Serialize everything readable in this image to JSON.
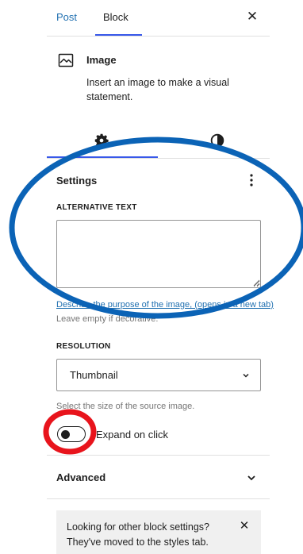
{
  "header": {
    "tabs": [
      {
        "label": "Post",
        "active": false
      },
      {
        "label": "Block",
        "active": true
      }
    ],
    "close_icon": "close-icon"
  },
  "block": {
    "icon": "image-icon",
    "title": "Image",
    "description": "Insert an image to make a visual statement."
  },
  "inspector_tabs": [
    {
      "icon": "gear-icon",
      "name": "Settings",
      "active": true
    },
    {
      "icon": "contrast-icon",
      "name": "Styles",
      "active": false
    }
  ],
  "settings": {
    "title": "Settings",
    "menu_icon": "more-vertical-icon",
    "alt_text": {
      "label": "ALTERNATIVE TEXT",
      "value": "",
      "help_link": "Describe the purpose of the image, (opens in a new tab)",
      "help_text": "Leave empty if decorative."
    },
    "resolution": {
      "label": "RESOLUTION",
      "value": "Thumbnail",
      "help_text": "Select the size of the source image."
    },
    "expand_on_click": {
      "label": "Expand on click",
      "checked": false
    }
  },
  "advanced": {
    "title": "Advanced",
    "expanded": false
  },
  "notice": {
    "text": "Looking for other block settings? They've moved to the styles tab."
  },
  "annotations": {
    "ellipse_color": "#0b63b6",
    "circle_color": "#e8141c"
  }
}
